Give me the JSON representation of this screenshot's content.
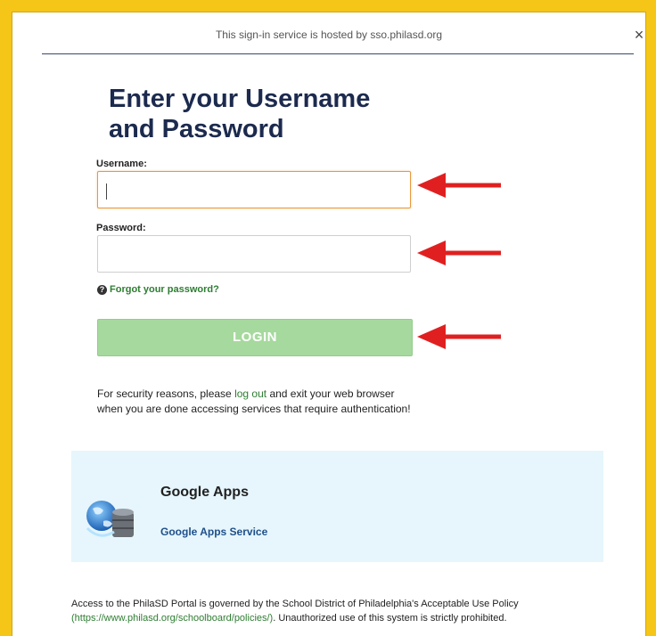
{
  "header": {
    "host_note": "This sign-in service is hosted by sso.philasd.org",
    "close_glyph": "×"
  },
  "form": {
    "title_line1": "Enter your Username",
    "title_line2": "and Password",
    "username_label": "Username:",
    "username_value": "",
    "password_label": "Password:",
    "password_value": "",
    "forgot_link": "Forgot your password?",
    "help_glyph": "?",
    "login_label": "LOGIN"
  },
  "security": {
    "before": "For security reasons, please ",
    "link": "log out",
    "after": " and exit your web browser when you are done accessing services that require authentication!"
  },
  "apps": {
    "title": "Google Apps",
    "link": "Google Apps Service",
    "icon": "globe-database-icon"
  },
  "policy": {
    "line1": "Access to the PhilaSD Portal is governed by the School District of Philadelphia's Acceptable Use Policy",
    "line2_url": "(https://www.philasd.org/schoolboard/policies/)",
    "line2_rest": ". Unauthorized use of this system is strictly prohibited."
  },
  "colors": {
    "frame_background": "#f5c518",
    "title": "#1c2a4e",
    "link_green": "#2e7d32",
    "login_button": "#a6d99d",
    "annotation_arrow": "#e02020",
    "apps_box": "#e6f6fc"
  },
  "annotations": {
    "arrows": 3
  }
}
